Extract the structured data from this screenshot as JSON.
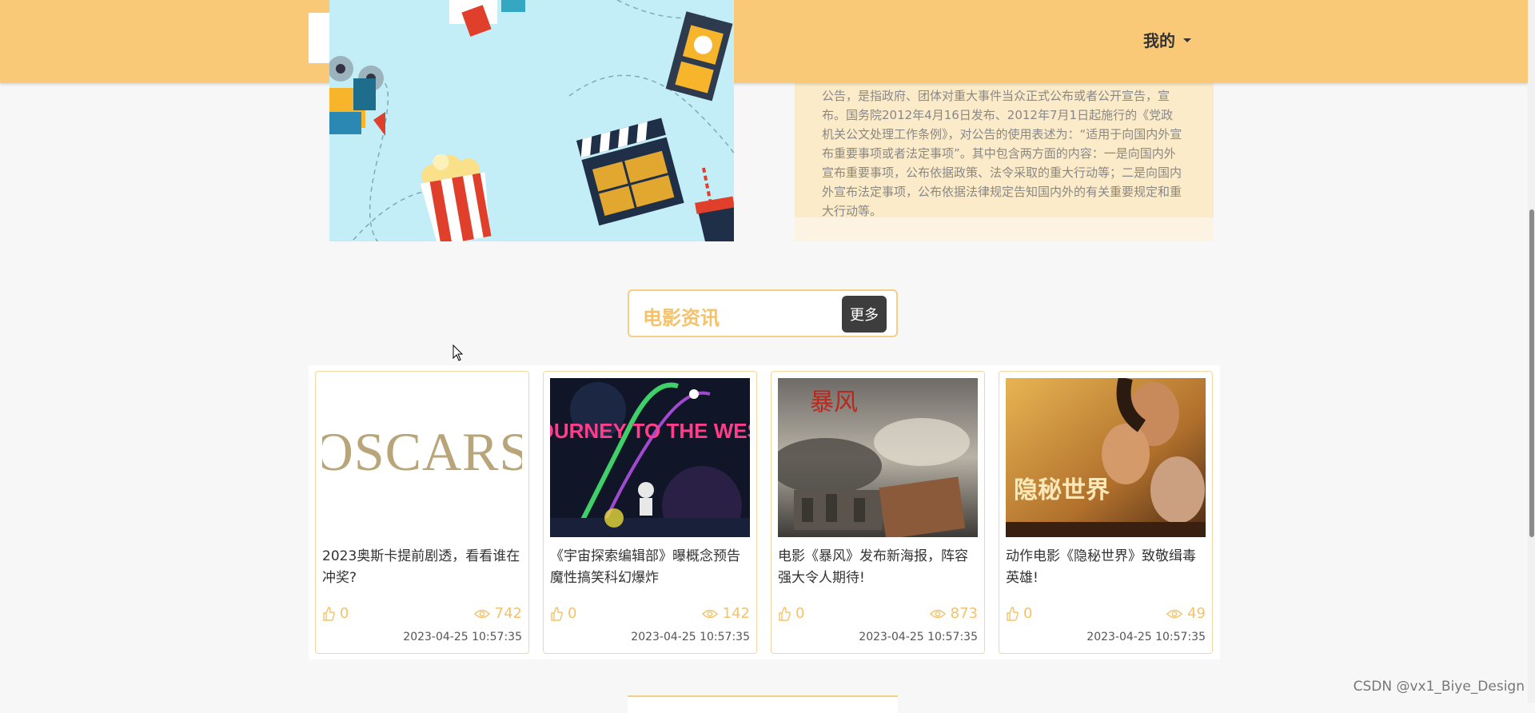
{
  "header": {
    "user_menu_label": "我的"
  },
  "notice": {
    "text": "公告，是指政府、团体对重大事件当众正式公布或者公开宣告，宣布。国务院2012年4月16日发布、2012年7月1日起施行的《党政机关公文处理工作条例》，对公告的使用表述为：“适用于向国内外宣布重要事项或者法定事项”。其中包含两方面的内容：一是向国内外宣布重要事项，公布依据政策、法令采取的重大行动等；二是向国内外宣布法定事项，公布依据法律规定告知国内外的有关重要规定和重大行动等。"
  },
  "news_section": {
    "title": "电影资讯",
    "more_label": "更多"
  },
  "cards": [
    {
      "image_text": "OSCARS",
      "title": "2023奥斯卡提前剧透，看看谁在冲奖?",
      "likes": "0",
      "views": "742",
      "time": "2023-04-25 10:57:35"
    },
    {
      "image_text": "JOURNEY TO THE WEST",
      "title": "《宇宙探索编辑部》曝概念预告 魔性搞笑科幻爆炸",
      "likes": "0",
      "views": "142",
      "time": "2023-04-25 10:57:35"
    },
    {
      "image_text": "暴风",
      "title": "电影《暴风》发布新海报，阵容强大令人期待!",
      "likes": "0",
      "views": "873",
      "time": "2023-04-25 10:57:35"
    },
    {
      "image_text": "隐秘世界",
      "title": "动作电影《隐秘世界》致敬缉毒英雄!",
      "likes": "0",
      "views": "49",
      "time": "2023-04-25 10:57:35"
    }
  ],
  "watermark": "CSDN @vx1_Biye_Design",
  "colors": {
    "header_bg": "#f9c977",
    "accent": "#f4c26a",
    "notice_bg": "#fcebc8",
    "banner_bg": "#c4eef7",
    "button_bg": "#3d3d3d"
  }
}
